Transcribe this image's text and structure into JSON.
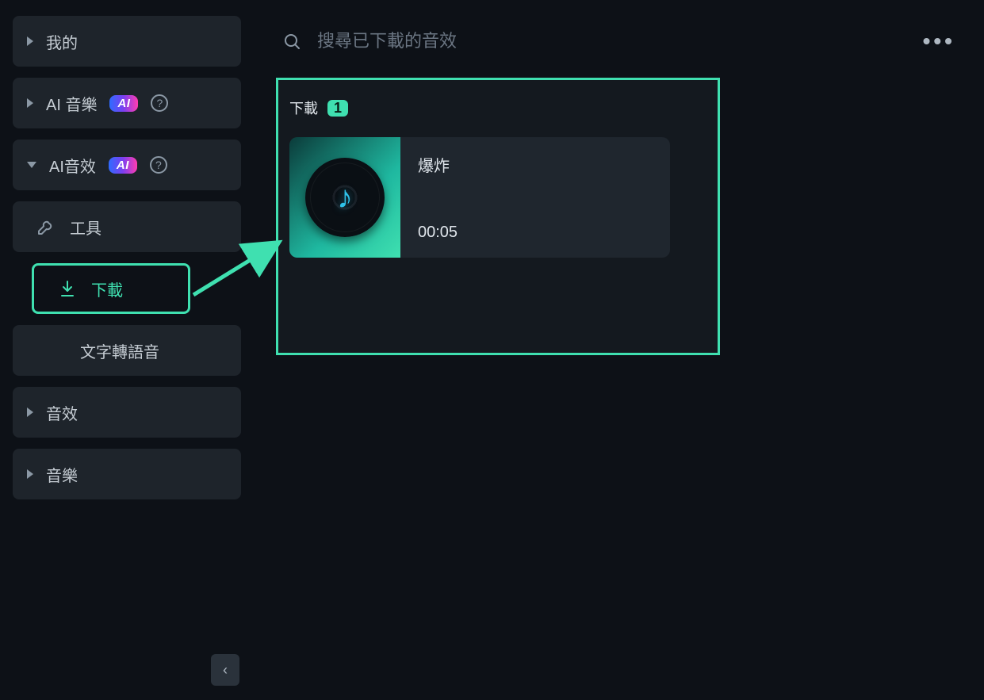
{
  "sidebar": {
    "mine": "我的",
    "aiMusic": "AI 音樂",
    "aiSfx": "AI音效",
    "aiBadge": "AI",
    "help": "?",
    "tools": "工具",
    "download": "下載",
    "tts": "文字轉語音",
    "sfx": "音效",
    "music": "音樂",
    "collapse": "‹"
  },
  "search": {
    "placeholder": "搜尋已下載的音效"
  },
  "more": "•••",
  "panel": {
    "title": "下載",
    "count": "1"
  },
  "clip": {
    "name": "爆炸",
    "duration": "00:05"
  }
}
